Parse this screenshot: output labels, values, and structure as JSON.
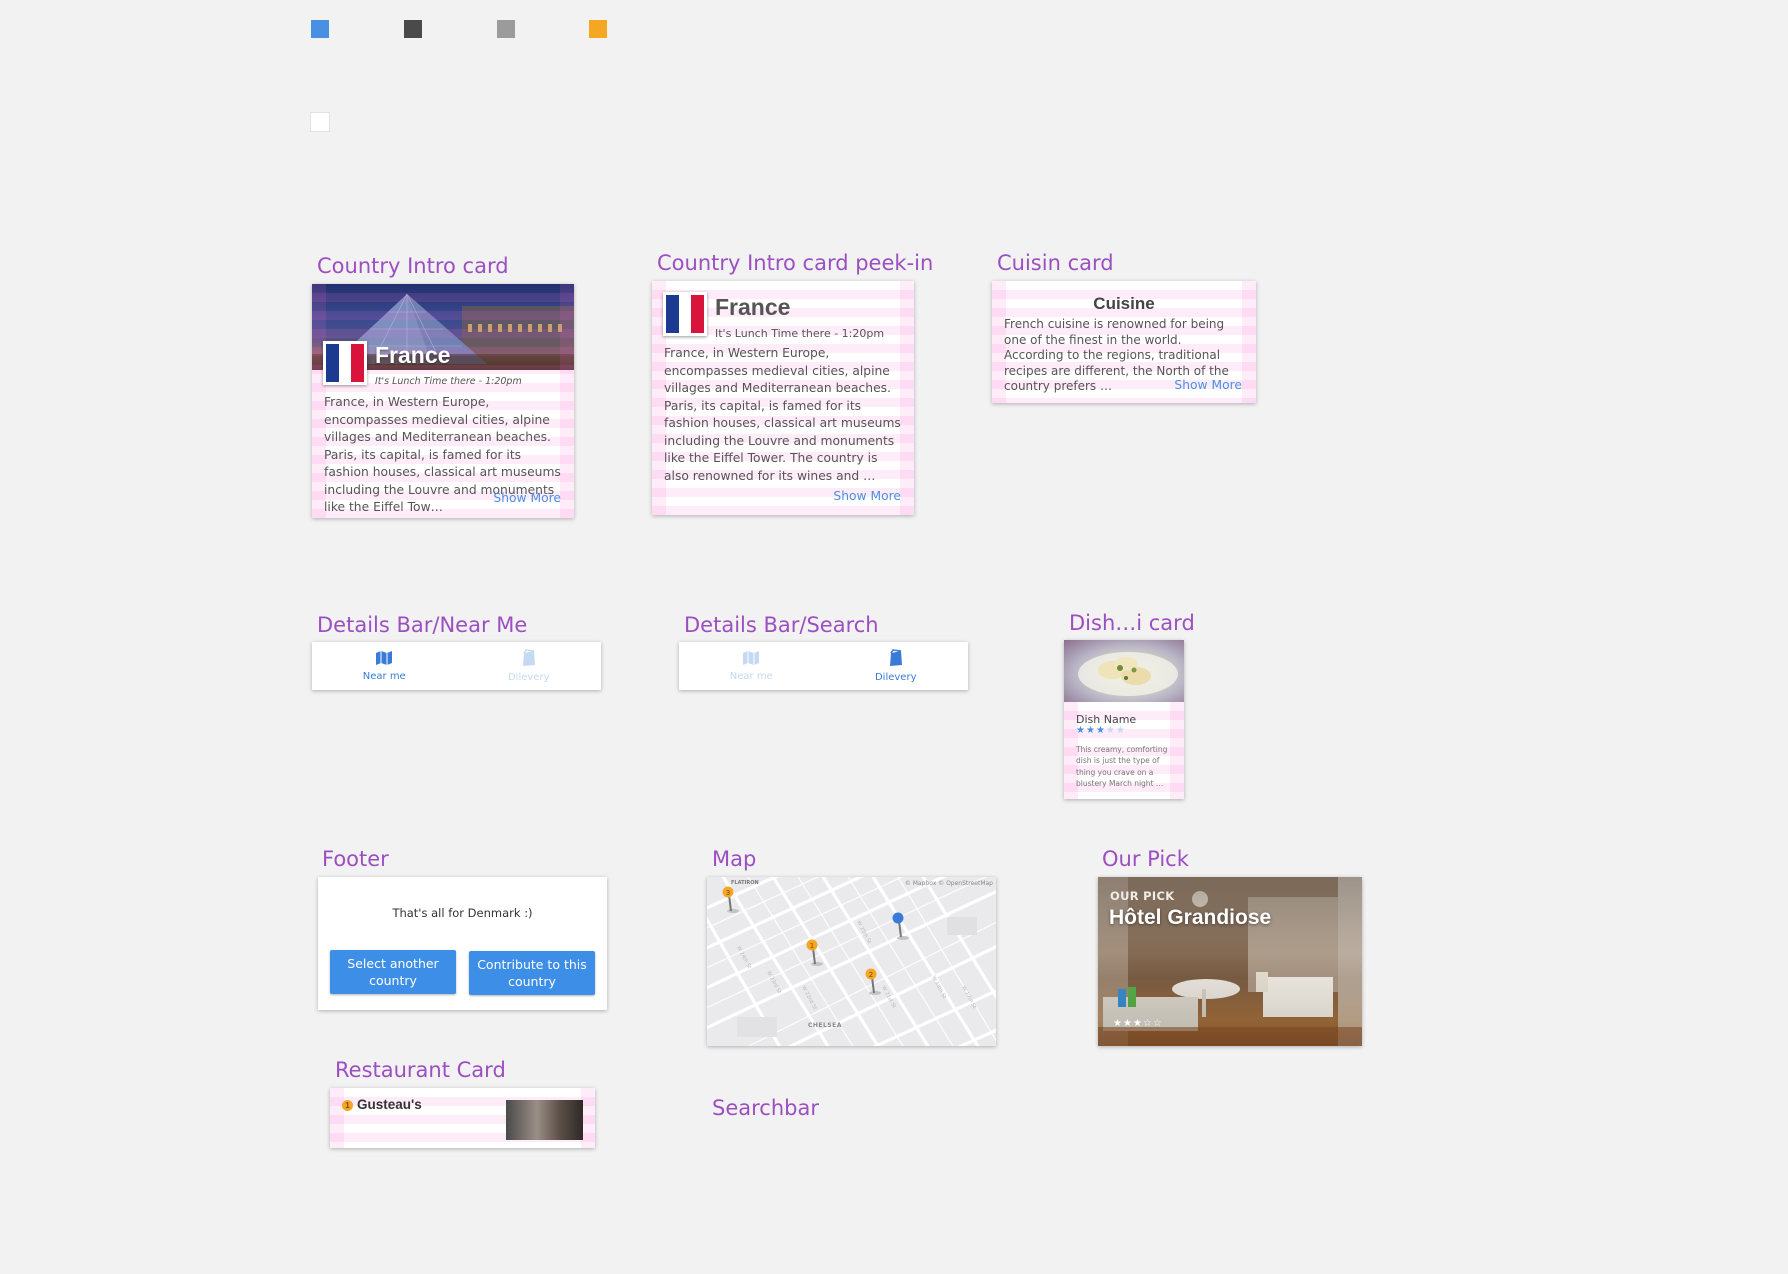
{
  "palette": {
    "colors": [
      "#4a90e2",
      "#4a4a4a",
      "#9b9b9b",
      "#f5a623",
      "#ffffff"
    ]
  },
  "artboards": {
    "country_intro": "Country Intro card",
    "country_intro_peek": "Country Intro card peek-in",
    "cuisine": "Cuisin card",
    "details_near": "Details Bar/Near Me",
    "details_search": "Details Bar/Search",
    "dish": "Dish…i card",
    "footer": "Footer",
    "map": "Map",
    "our_pick": "Our Pick",
    "restaurant": "Restaurant Card",
    "searchbar": "Searchbar"
  },
  "country_card": {
    "country": "France",
    "time": "It's Lunch Time there - 1:20pm",
    "description": "France, in Western Europe, encompasses medieval cities, alpine villages and Mediterranean beaches. Paris, its capital, is famed for its fashion houses, classical art museums including the Louvre and monuments like the Eiffel Tow…",
    "show_more": "Show More",
    "flag_icon": "france-flag-icon"
  },
  "country_peek": {
    "country": "France",
    "time": "It's Lunch Time there - 1:20pm",
    "description": "France, in Western Europe, encompasses medieval cities, alpine villages and Mediterranean beaches. Paris, its capital, is famed for its fashion houses, classical art museums including the Louvre and monuments like the Eiffel Tower. The country is also renowned for its wines and …",
    "show_more": "Show More"
  },
  "cuisine_card": {
    "title": "Cuisine",
    "description": "French cuisine is renowned for being one of the finest in the world.  According to the regions, traditional recipes are different, the North of the country prefers …",
    "show_more": "Show More"
  },
  "details_bar_near": {
    "tab_near": "Near me",
    "tab_delivery": "Dilevery",
    "active": "near"
  },
  "details_bar_search": {
    "tab_near": "Near me",
    "tab_delivery": "Dilevery",
    "active": "delivery"
  },
  "dish_card": {
    "name": "Dish Name",
    "rating": 3,
    "max_rating": 5,
    "description": "This creamy, comforting dish is just the type of thing you crave on a blustery March night …"
  },
  "footer": {
    "message": "That's all for Denmark :)",
    "button_select": "Select another country",
    "button_contribute": "Contribute to this country"
  },
  "map": {
    "attribution": "© Mapbox © OpenStreetMap",
    "label_flatiron": "FLATIRON",
    "label_chelsea": "CHELSEA",
    "pins": [
      "3",
      "1",
      "2"
    ]
  },
  "our_pick": {
    "eyebrow": "OUR PICK",
    "title": "Hôtel Grandiose",
    "rating": 3,
    "max_rating": 5
  },
  "restaurant_card": {
    "number": "1",
    "name": "Gusteau's"
  }
}
